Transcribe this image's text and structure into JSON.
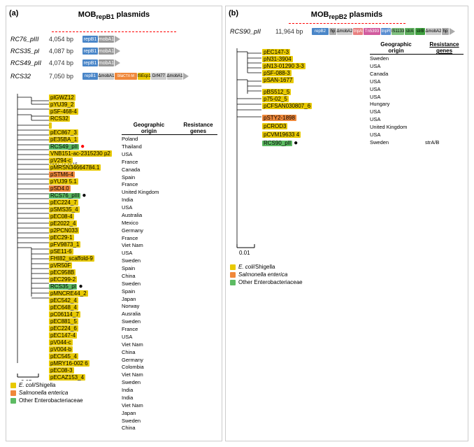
{
  "panels": {
    "left": {
      "label": "(a)",
      "title": "MOB",
      "title_sub": "repB1",
      "title_suffix": " plasmids",
      "plasmids": [
        {
          "name": "RC76_pIII",
          "size": "4,054 bp",
          "genes": [
            "repB1",
            "mobA1"
          ],
          "has_arrow": true,
          "color_arrow": "#aaa"
        },
        {
          "name": "RCS35_pl",
          "size": "4,087 bp",
          "genes": [
            "repB1",
            "mobA1"
          ],
          "has_arrow": true,
          "color_arrow": "#aaa"
        },
        {
          "name": "RCS49_pII",
          "size": "4,074 bp",
          "genes": [
            "repB1",
            "mobA1"
          ],
          "has_arrow": true,
          "color_arrow": "#aaa"
        },
        {
          "name": "RCS32",
          "size": "7,050 bp",
          "genes": [
            "repB1",
            "ΔmobA1",
            "bla_CTX-M-15",
            "ISEcp1",
            "Drf477",
            "ΔmobA1"
          ],
          "has_arrow": true,
          "color_arrow": "#aaa"
        }
      ],
      "tree_nodes": [
        {
          "label": "plGWZ12",
          "color": "yellow"
        },
        {
          "label": "pYU39_2",
          "color": "yellow"
        },
        {
          "label": "pSF-468-4",
          "color": "yellow"
        },
        {
          "label": "RCS32",
          "color": "green"
        },
        {
          "label": "pEC867_3",
          "color": "yellow"
        },
        {
          "label": "pE35BA_1",
          "color": "yellow"
        },
        {
          "label": "RCS49_pII",
          "color": "green",
          "dot": "red"
        },
        {
          "label": "VNB151-ac-2315230 p2",
          "color": "yellow"
        },
        {
          "label": "pV294-c",
          "color": "yellow"
        },
        {
          "label": "pMRSN34664784.1",
          "color": "yellow"
        },
        {
          "label": "pSTM6-4",
          "color": "orange"
        },
        {
          "label": "pYU39 5.1",
          "color": "yellow"
        },
        {
          "label": "pSD4.0",
          "color": "orange"
        },
        {
          "label": "RCS76_pIII",
          "color": "green",
          "dot": "black"
        },
        {
          "label": "pEC224_7",
          "color": "yellow"
        },
        {
          "label": "pSMS35_4",
          "color": "yellow"
        },
        {
          "label": "pEC08-4",
          "color": "yellow"
        },
        {
          "label": "pE2022_4",
          "color": "yellow"
        },
        {
          "label": "p2PCN033",
          "color": "yellow"
        },
        {
          "label": "pEC29-1",
          "color": "yellow"
        },
        {
          "label": "pFV9873_1",
          "color": "yellow"
        },
        {
          "label": "pSE11-6",
          "color": "yellow"
        },
        {
          "label": "FHI82_scaffold-9",
          "color": "yellow"
        },
        {
          "label": "pVR50F",
          "color": "yellow"
        },
        {
          "label": "pEC958B",
          "color": "yellow"
        },
        {
          "label": "pEC299-2",
          "color": "yellow"
        },
        {
          "label": "RCS35_pl",
          "color": "green",
          "dot": "black"
        },
        {
          "label": "pEC299-2",
          "color": "yellow"
        },
        {
          "label": "pMNCRE44_2",
          "color": "yellow"
        },
        {
          "label": "pEC542_4",
          "color": "yellow"
        },
        {
          "label": "pEC648_4",
          "color": "yellow"
        },
        {
          "label": "pC06114_7",
          "color": "yellow"
        },
        {
          "label": "pEC881_5",
          "color": "yellow"
        },
        {
          "label": "pEC224_6",
          "color": "yellow"
        },
        {
          "label": "pEC147-4",
          "color": "yellow"
        },
        {
          "label": "pV044-c",
          "color": "yellow"
        },
        {
          "label": "pV004-b",
          "color": "yellow"
        },
        {
          "label": "pEC545_4",
          "color": "yellow"
        },
        {
          "label": "pMRY16-002 6",
          "color": "yellow"
        },
        {
          "label": "pEC08-3",
          "color": "yellow"
        },
        {
          "label": "pECAZ153_4",
          "color": "yellow"
        }
      ],
      "geo_table": {
        "headers": [
          "Geographic origin",
          "Resistance genes"
        ],
        "rows": [
          {
            "origin": "Poland",
            "genes": ""
          },
          {
            "origin": "Thailand",
            "genes": ""
          },
          {
            "origin": "USA",
            "genes": ""
          },
          {
            "origin": "France",
            "genes": ""
          },
          {
            "origin": "Canada",
            "genes": ""
          },
          {
            "origin": "Spain",
            "genes": ""
          },
          {
            "origin": "France",
            "genes": ""
          },
          {
            "origin": "United Kingdom",
            "genes": ""
          },
          {
            "origin": "India",
            "genes": ""
          },
          {
            "origin": "USA",
            "genes": ""
          },
          {
            "origin": "Australia",
            "genes": ""
          },
          {
            "origin": "Mexico",
            "genes": ""
          },
          {
            "origin": "Germany",
            "genes": ""
          },
          {
            "origin": "France",
            "genes": ""
          },
          {
            "origin": "Viet Nam",
            "genes": ""
          },
          {
            "origin": "USA",
            "genes": ""
          },
          {
            "origin": "Sweden",
            "genes": ""
          },
          {
            "origin": "Spain",
            "genes": ""
          },
          {
            "origin": "China",
            "genes": ""
          },
          {
            "origin": "Sweden",
            "genes": ""
          },
          {
            "origin": "Spain",
            "genes": ""
          },
          {
            "origin": "Japan",
            "genes": ""
          },
          {
            "origin": "Norway",
            "genes": ""
          },
          {
            "origin": "Ausralia",
            "genes": ""
          },
          {
            "origin": "Sweden",
            "genes": ""
          },
          {
            "origin": "France",
            "genes": ""
          },
          {
            "origin": "USA",
            "genes": ""
          },
          {
            "origin": "Viet Nam",
            "genes": ""
          },
          {
            "origin": "China",
            "genes": ""
          },
          {
            "origin": "Germany",
            "genes": ""
          },
          {
            "origin": "Colombia",
            "genes": ""
          },
          {
            "origin": "Viet Nam",
            "genes": ""
          },
          {
            "origin": "Sweden",
            "genes": ""
          },
          {
            "origin": "India",
            "genes": ""
          },
          {
            "origin": "India",
            "genes": ""
          },
          {
            "origin": "Viet Nam",
            "genes": ""
          },
          {
            "origin": "Japan",
            "genes": ""
          },
          {
            "origin": "Sweden",
            "genes": ""
          },
          {
            "origin": "China",
            "genes": ""
          }
        ]
      },
      "bla_label": "bla_CTX-M-15",
      "scale": "0.05"
    },
    "right": {
      "label": "(b)",
      "title": "MOB",
      "title_sub": "repB2",
      "title_suffix": " plasmids",
      "plasmid": {
        "name": "RCS90_pII",
        "size": "11,964 bp",
        "genes": [
          "repB2",
          "hp",
          "ΔmobA2",
          "tnpA",
          "Tn5393",
          "tnpR",
          "IS1133",
          "strA",
          "strB",
          "ΔmobA2",
          "hp"
        ]
      },
      "tree_nodes": [
        {
          "label": "pEC147-3",
          "color": "yellow"
        },
        {
          "label": "pN31-3904",
          "color": "yellow"
        },
        {
          "label": "pN13-01290 3-3",
          "color": "yellow"
        },
        {
          "label": "pSF-088-3",
          "color": "yellow"
        },
        {
          "label": "pSAN-1677",
          "color": "yellow"
        },
        {
          "label": "pBS512_5",
          "color": "yellow"
        },
        {
          "label": "p75-02_5",
          "color": "yellow"
        },
        {
          "label": "pCFSAN030807_6",
          "color": "yellow"
        },
        {
          "label": "pSTY2-1898",
          "color": "orange"
        },
        {
          "label": "pCROD3",
          "color": "yellow"
        },
        {
          "label": "pCVM19633 4",
          "color": "yellow"
        },
        {
          "label": "RCS90_pII",
          "color": "green",
          "dot": "black"
        }
      ],
      "geo_table": {
        "headers": [
          "Geographic origin",
          "Resistance genes"
        ],
        "rows": [
          {
            "origin": "Sweden",
            "genes": ""
          },
          {
            "origin": "USA",
            "genes": ""
          },
          {
            "origin": "Canada",
            "genes": ""
          },
          {
            "origin": "USA",
            "genes": ""
          },
          {
            "origin": "USA",
            "genes": ""
          },
          {
            "origin": "USA",
            "genes": ""
          },
          {
            "origin": "Hungary",
            "genes": ""
          },
          {
            "origin": "USA",
            "genes": ""
          },
          {
            "origin": "USA",
            "genes": ""
          },
          {
            "origin": "United Kingdom",
            "genes": ""
          },
          {
            "origin": "USA",
            "genes": ""
          },
          {
            "origin": "Sweden",
            "genes": "strA/B"
          }
        ]
      },
      "scale": "0.01"
    }
  },
  "legend": {
    "items": [
      {
        "color": "#e8c900",
        "label": "E. coli/Shigella"
      },
      {
        "color": "#f0883a",
        "label": "Salmonella enterica"
      },
      {
        "color": "#5dbb63",
        "label": "Other Enterobacteriaceae"
      }
    ]
  }
}
